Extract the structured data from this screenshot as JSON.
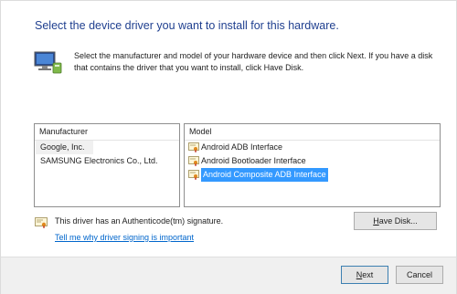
{
  "dialog": {
    "heading": "Select the device driver you want to install for this hardware.",
    "intro": "Select the manufacturer and model of your hardware device and then click Next. If you have a disk that contains the driver that you want to install, click Have Disk."
  },
  "manufacturer": {
    "header": "Manufacturer",
    "items": [
      "Google, Inc.",
      "SAMSUNG Electronics Co., Ltd."
    ],
    "selected": "Google, Inc."
  },
  "model": {
    "header": "Model",
    "items": [
      "Android ADB Interface",
      "Android Bootloader Interface",
      "Android Composite ADB Interface"
    ],
    "selected": "Android Composite ADB Interface"
  },
  "signature": {
    "text": "This driver has an Authenticode(tm) signature.",
    "link": "Tell me why driver signing is important"
  },
  "buttons": {
    "have_disk_prefix": "H",
    "have_disk_rest": "ave Disk...",
    "next_prefix": "N",
    "next_rest": "ext",
    "cancel": "Cancel"
  },
  "colors": {
    "heading": "#1f3f8f",
    "selection": "#3399ff",
    "link": "#0066cc"
  },
  "icons": {
    "monitor": "monitor-icon",
    "certificate": "certificate-icon"
  }
}
